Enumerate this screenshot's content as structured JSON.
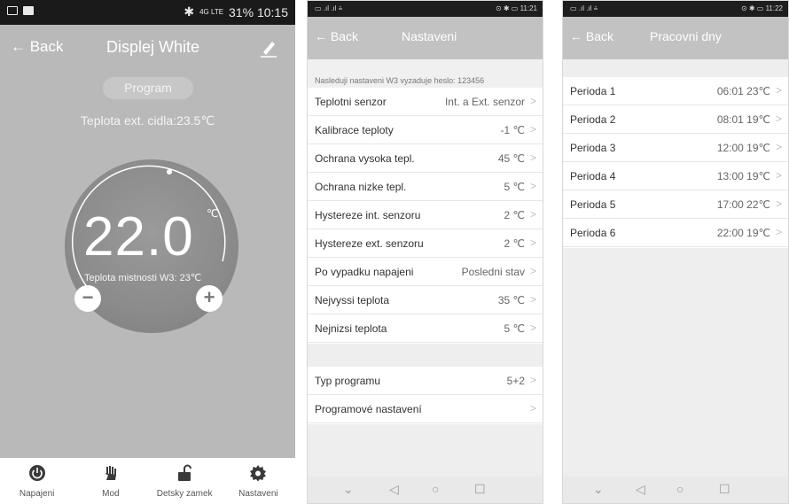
{
  "screen1": {
    "status": {
      "right": "31% 10:15",
      "signal": "4G LTE"
    },
    "header": {
      "back": "← Back",
      "title": "Displej White"
    },
    "program_button": "Program",
    "ext_temp": "Teplota ext. cidla:23.5℃",
    "current_temp": "22.0",
    "unit": "℃",
    "room_temp": "Teplota mistnosti W3:  23℃",
    "minus": "−",
    "plus": "+",
    "nav": [
      {
        "label": "Napajeni",
        "icon": "power-icon"
      },
      {
        "label": "Mod",
        "icon": "hand-icon"
      },
      {
        "label": "Detsky zamek",
        "icon": "unlock-icon"
      },
      {
        "label": "Nastaveni",
        "icon": "gear-icon"
      }
    ],
    "colors": {
      "bg": "#b9b9b9",
      "dial": "#8b8b8b"
    }
  },
  "screen2": {
    "status": {
      "left": "▭ .ıl .ıl ⩮",
      "right": "⊙ ✱ ▭ 11:21"
    },
    "header": {
      "back": "← Back",
      "title": "Nastaveni"
    },
    "note": "Nasleduji nastaveni W3 vyzaduje heslo: 123456",
    "rows": [
      {
        "label": "Teplotni senzor",
        "value": "Int. a Ext. senzor"
      },
      {
        "label": "Kalibrace teploty",
        "value": "-1  ℃"
      },
      {
        "label": "Ochrana vysoka tepl.",
        "value": "45  ℃"
      },
      {
        "label": "Ochrana nizke tepl.",
        "value": "5  ℃"
      },
      {
        "label": "Hystereze int. senzoru",
        "value": "2  ℃"
      },
      {
        "label": "Hystereze ext. senzoru",
        "value": "2  ℃"
      },
      {
        "label": "Po vypadku napajeni",
        "value": "Posledni stav"
      },
      {
        "label": "Nejvyssi teplota",
        "value": "35  ℃"
      },
      {
        "label": "Nejnizsi  teplota",
        "value": "5  ℃"
      }
    ],
    "rows2": [
      {
        "label": "Typ programu",
        "value": "5+2"
      },
      {
        "label": "Programové nastavení",
        "value": ""
      }
    ],
    "chevron": ">"
  },
  "screen3": {
    "status": {
      "left": "▭ .ıl .ıl ⩮",
      "right": "⊙ ✱ ▭ 11:22"
    },
    "header": {
      "back": "← Back",
      "title": "Pracovni dny"
    },
    "rows": [
      {
        "label": "Perioda 1",
        "value": "06:01  23℃"
      },
      {
        "label": "Perioda 2",
        "value": "08:01  19℃"
      },
      {
        "label": "Perioda 3",
        "value": "12:00  19℃"
      },
      {
        "label": "Perioda 4",
        "value": "13:00  19℃"
      },
      {
        "label": "Perioda 5",
        "value": "17:00  22℃"
      },
      {
        "label": "Perioda 6",
        "value": "22:00  19℃"
      }
    ],
    "chevron": ">"
  },
  "sysnav": {
    "down": "⌄",
    "back": "◁",
    "home": "○",
    "recent": "☐"
  }
}
